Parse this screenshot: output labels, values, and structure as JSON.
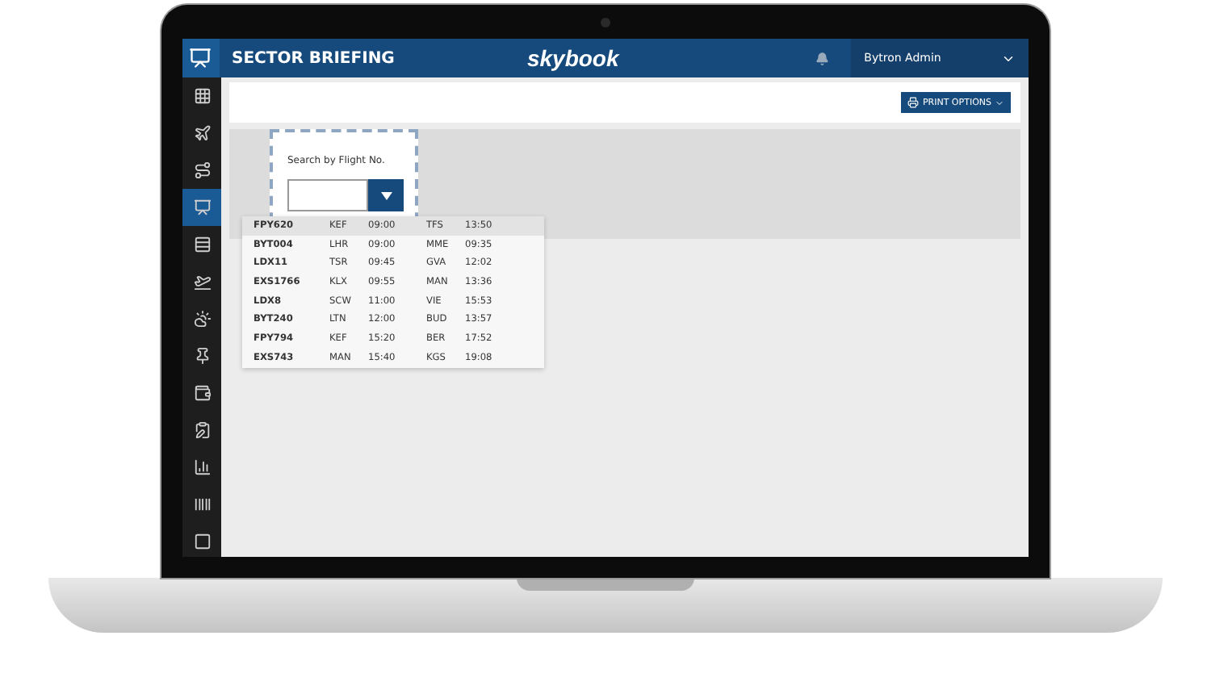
{
  "header": {
    "title": "SECTOR BRIEFING",
    "logo": "skybook",
    "user": "Bytron Admin"
  },
  "sidebar": {
    "items": [
      {
        "selected": false
      },
      {
        "selected": false
      },
      {
        "selected": false
      },
      {
        "selected": true
      },
      {
        "selected": false
      },
      {
        "selected": false
      },
      {
        "selected": false
      },
      {
        "selected": false
      },
      {
        "selected": false
      },
      {
        "selected": false
      },
      {
        "selected": false
      },
      {
        "selected": false
      },
      {
        "selected": false
      }
    ]
  },
  "toolbar": {
    "print_button": "PRINT OPTIONS"
  },
  "search": {
    "label": "Search by Flight No."
  },
  "flights": [
    {
      "flight": "FPY620",
      "from": "KEF",
      "dep": "09:00",
      "to": "TFS",
      "arr": "13:50",
      "highlighted": true
    },
    {
      "flight": "BYT004",
      "from": "LHR",
      "dep": "09:00",
      "to": "MME",
      "arr": "09:35",
      "highlighted": false
    },
    {
      "flight": "LDX11",
      "from": "TSR",
      "dep": "09:45",
      "to": "GVA",
      "arr": "12:02",
      "highlighted": false
    },
    {
      "flight": "EXS1766",
      "from": "KLX",
      "dep": "09:55",
      "to": "MAN",
      "arr": "13:36",
      "highlighted": false
    },
    {
      "flight": "LDX8",
      "from": "SCW",
      "dep": "11:00",
      "to": "VIE",
      "arr": "15:53",
      "highlighted": false
    },
    {
      "flight": "BYT240",
      "from": "LTN",
      "dep": "12:00",
      "to": "BUD",
      "arr": "13:57",
      "highlighted": false
    },
    {
      "flight": "FPY794",
      "from": "KEF",
      "dep": "15:20",
      "to": "BER",
      "arr": "17:52",
      "highlighted": false
    },
    {
      "flight": "EXS743",
      "from": "MAN",
      "dep": "15:40",
      "to": "KGS",
      "arr": "19:08",
      "highlighted": false
    }
  ]
}
